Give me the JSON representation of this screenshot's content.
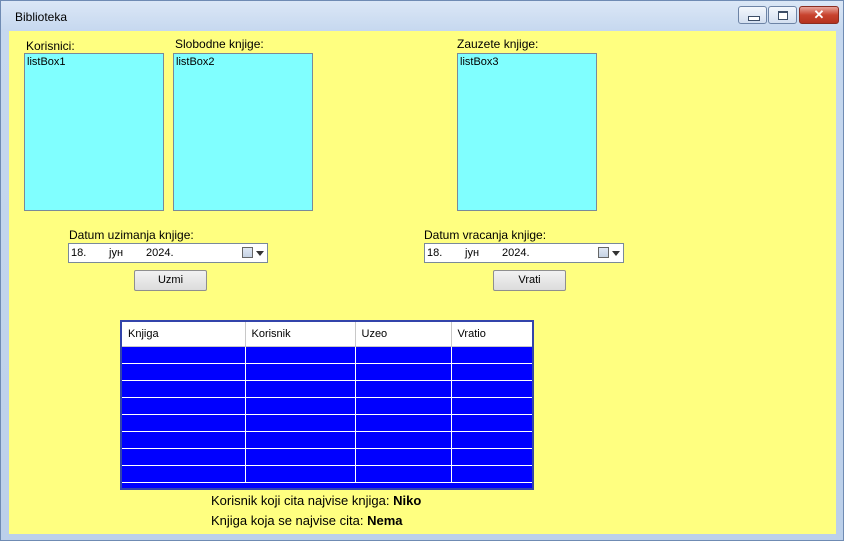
{
  "window": {
    "title": "Biblioteka"
  },
  "labels": {
    "korisnici": "Korisnici:",
    "slobodne": "Slobodne knjige:",
    "zauzete": "Zauzete knjige:",
    "datum_uzimanja": "Datum uzimanja knjige:",
    "datum_vracanja": "Datum vracanja knjige:"
  },
  "listboxes": {
    "korisnici": "listBox1",
    "slobodne": "listBox2",
    "zauzete": "listBox3"
  },
  "date_uzimanja": {
    "day": "18.",
    "month": "јун",
    "year": "2024."
  },
  "date_vracanja": {
    "day": "18.",
    "month": "јун",
    "year": "2024."
  },
  "buttons": {
    "uzmi": "Uzmi",
    "vrati": "Vrati"
  },
  "grid": {
    "columns": [
      "Knjiga",
      "Korisnik",
      "Uzeo",
      "Vratio"
    ],
    "rows": 8,
    "color": "#0000FF"
  },
  "info": {
    "reader_label": "Korisnik koji cita najvise knjiga:",
    "reader_value": "Niko",
    "book_label": "Knjiga koja se najvise cita:",
    "book_value": "Nema"
  },
  "colors": {
    "background": "#FFFF80",
    "listbox": "#80FFFF"
  }
}
